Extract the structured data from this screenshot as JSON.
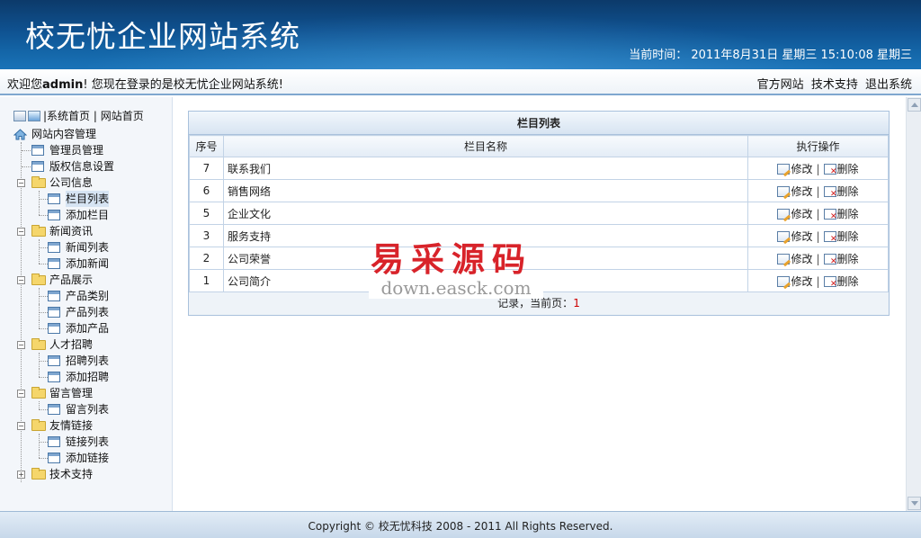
{
  "header": {
    "title": "校无忧企业网站系统",
    "clock_label": "当前时间：",
    "clock_value": "2011年8月31日 星期三 15:10:08 星期三"
  },
  "welcome": {
    "prefix": "欢迎您",
    "user": "admin",
    "suffix": "! 您现在登录的是校无忧企业网站系统!",
    "links": [
      "官方网站",
      "技术支持",
      "退出系统"
    ]
  },
  "sidebar": {
    "top_links": {
      "system_home": "系统首页",
      "site_home": "网站首页",
      "sep": "|"
    },
    "root": "网站内容管理",
    "items": [
      {
        "label": "管理员管理"
      },
      {
        "label": "版权信息设置"
      },
      {
        "label": "公司信息",
        "children": [
          "栏目列表",
          "添加栏目"
        ]
      },
      {
        "label": "新闻资讯",
        "children": [
          "新闻列表",
          "添加新闻"
        ]
      },
      {
        "label": "产品展示",
        "children": [
          "产品类别",
          "产品列表",
          "添加产品"
        ]
      },
      {
        "label": "人才招聘",
        "children": [
          "招聘列表",
          "添加招聘"
        ]
      },
      {
        "label": "留言管理",
        "children": [
          "留言列表"
        ]
      },
      {
        "label": "友情链接",
        "children": [
          "链接列表",
          "添加链接"
        ]
      },
      {
        "label": "技术支持"
      }
    ],
    "selected": "栏目列表"
  },
  "panel": {
    "title": "栏目列表",
    "columns": [
      "序号",
      "栏目名称",
      "执行操作"
    ],
    "rows": [
      {
        "id": "7",
        "name": "联系我们"
      },
      {
        "id": "6",
        "name": "销售网络"
      },
      {
        "id": "5",
        "name": "企业文化"
      },
      {
        "id": "3",
        "name": "服务支持"
      },
      {
        "id": "2",
        "name": "公司荣誉"
      },
      {
        "id": "1",
        "name": "公司简介"
      }
    ],
    "edit_label": "修改",
    "delete_label": "删除",
    "op_sep": "|",
    "footer_text": "记录，当前页：",
    "current_page": "1"
  },
  "watermark": {
    "cn": "易采源码",
    "en": "down.easck.com"
  },
  "footer": {
    "copyright": "Copyright © 校无忧科技  2008 - 2011 All Rights Reserved."
  },
  "colors": {
    "header_bg": "#0f5291",
    "accent_red": "#d8232a",
    "border": "#a9c1dc"
  }
}
